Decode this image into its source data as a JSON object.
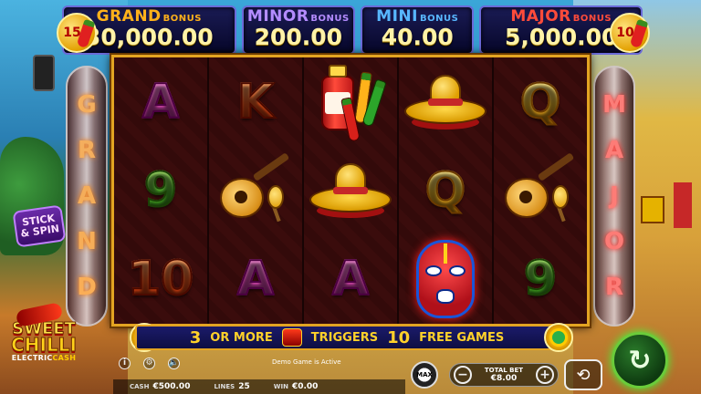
{
  "jackpots": {
    "grand": {
      "name": "GRAND",
      "bonus": "BONUS",
      "value": "30,000.00"
    },
    "minor": {
      "name": "MINOR",
      "bonus": "BONUS",
      "value": "200.00"
    },
    "mini": {
      "name": "MINI",
      "bonus": "BONUS",
      "value": "40.00"
    },
    "major": {
      "name": "MAJOR",
      "bonus": "BONUS",
      "value": "5,000.00"
    }
  },
  "badges": {
    "left": "15",
    "right": "10"
  },
  "pipes": {
    "left": [
      "G",
      "R",
      "A",
      "N",
      "D"
    ],
    "right": [
      "M",
      "A",
      "J",
      "O",
      "R"
    ]
  },
  "reels": [
    [
      {
        "symbol": "A",
        "style": "pink"
      },
      {
        "symbol": "9",
        "style": "green"
      },
      {
        "symbol": "10",
        "style": "orange"
      }
    ],
    [
      {
        "symbol": "K",
        "style": "orange"
      },
      {
        "symbol": "guitar-maracas",
        "style": "art"
      },
      {
        "symbol": "A",
        "style": "pink"
      }
    ],
    [
      {
        "symbol": "hot-sauce-chillies",
        "style": "art"
      },
      {
        "symbol": "sombrero",
        "style": "art"
      },
      {
        "symbol": "A",
        "style": "pink"
      }
    ],
    [
      {
        "symbol": "sombrero",
        "style": "art"
      },
      {
        "symbol": "Q",
        "style": "gold"
      },
      {
        "symbol": "luchador-mask",
        "style": "art"
      }
    ],
    [
      {
        "symbol": "Q",
        "style": "gold"
      },
      {
        "symbol": "guitar-maracas",
        "style": "art"
      },
      {
        "symbol": "9",
        "style": "green"
      }
    ]
  ],
  "stick_spin": {
    "line1": "STICK",
    "line2": "& SPIN"
  },
  "logo": {
    "line1": "SWEET",
    "line2": "CHILLI",
    "sub_a": "ELECTRIC",
    "sub_b": "CASH"
  },
  "banner": {
    "part1": "3",
    "part2": "OR MORE",
    "part3": "TRIGGERS",
    "part4": "10",
    "part5": "FREE GAMES"
  },
  "demo_text": "Demo Game is Active",
  "stats": {
    "cash_label": "CASH",
    "cash_value": "€500.00",
    "lines_label": "LINES",
    "lines_value": "25",
    "win_label": "WIN",
    "win_value": "€0.00"
  },
  "bet": {
    "label": "TOTAL BET",
    "value": "€8.00",
    "minus": "−",
    "plus": "+"
  },
  "max_label": "MAX",
  "icons": {
    "info": "i",
    "settings": "⚙",
    "sound": "🔈",
    "autoplay": "⟲",
    "spin": "↻"
  }
}
